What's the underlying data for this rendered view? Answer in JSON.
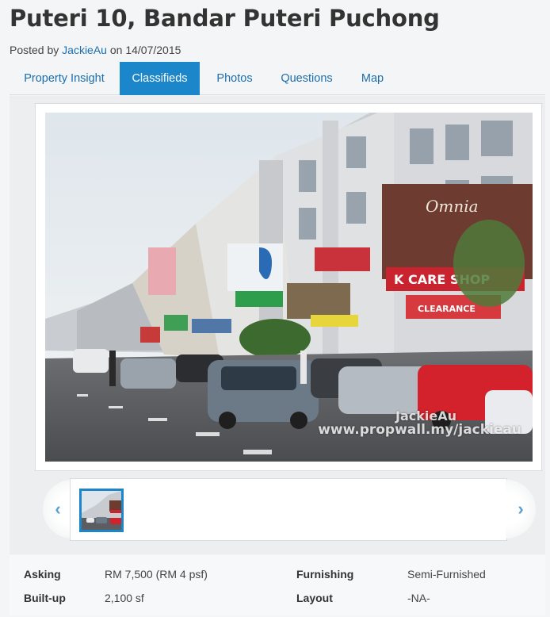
{
  "listing": {
    "title": "Puteri 10, Bandar Puteri Puchong",
    "posted_prefix": "Posted by",
    "author": "JackieAu",
    "date_prefix": "on",
    "date": "14/07/2015"
  },
  "tabs": [
    {
      "label": "Property Insight",
      "active": false
    },
    {
      "label": "Classifieds",
      "active": true
    },
    {
      "label": "Photos",
      "active": false
    },
    {
      "label": "Questions",
      "active": false
    },
    {
      "label": "Map",
      "active": false
    }
  ],
  "gallery": {
    "watermark_name": "JackieAu",
    "watermark_url": "www.propwall.my/jackieau",
    "photo_signs": {
      "store": "Omnia",
      "k_care": "K CARE SHOP",
      "clearance": "CLEARANCE"
    },
    "prev_icon": "chevron-left-icon",
    "next_icon": "chevron-right-icon",
    "accent_color": "#1b86c9"
  },
  "details": {
    "asking_label": "Asking",
    "asking_value": "RM 7,500 (RM 4 psf)",
    "builtup_label": "Built-up",
    "builtup_value": "2,100 sf",
    "furnishing_label": "Furnishing",
    "furnishing_value": "Semi-Furnished",
    "layout_label": "Layout",
    "layout_value": "-NA-"
  }
}
